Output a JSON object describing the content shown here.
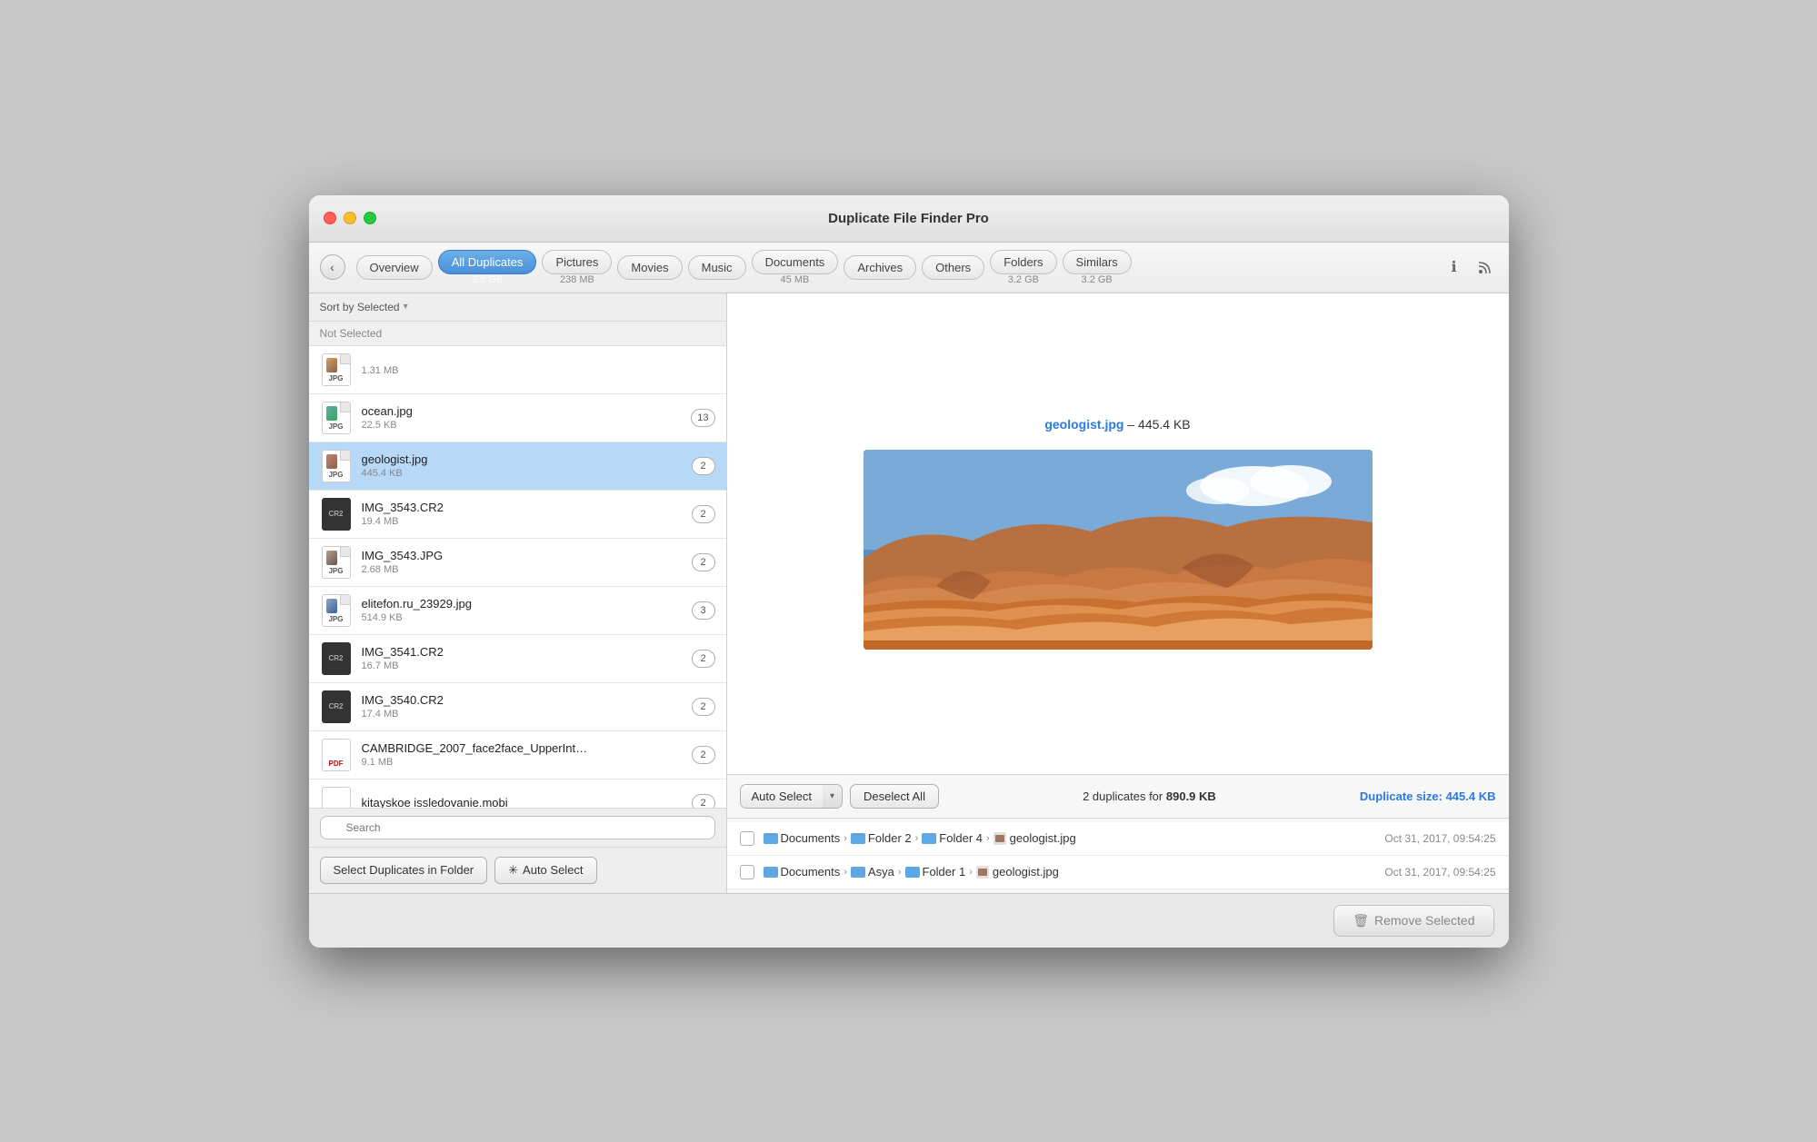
{
  "window": {
    "title": "Duplicate File Finder Pro"
  },
  "toolbar": {
    "back_label": "‹",
    "tabs": [
      {
        "id": "overview",
        "label": "Overview",
        "size": null,
        "active": false
      },
      {
        "id": "all-duplicates",
        "label": "All Duplicates",
        "size": "3.5 GB",
        "active": true
      },
      {
        "id": "pictures",
        "label": "Pictures",
        "size": "238 MB",
        "active": false
      },
      {
        "id": "movies",
        "label": "Movies",
        "size": null,
        "active": false
      },
      {
        "id": "music",
        "label": "Music",
        "size": null,
        "active": false
      },
      {
        "id": "documents",
        "label": "Documents",
        "size": "45 MB",
        "active": false
      },
      {
        "id": "archives",
        "label": "Archives",
        "size": null,
        "active": false
      },
      {
        "id": "others",
        "label": "Others",
        "size": null,
        "active": false
      },
      {
        "id": "folders",
        "label": "Folders",
        "size": "3.2 GB",
        "active": false
      },
      {
        "id": "similars",
        "label": "Similars",
        "size": "3.2 GB",
        "active": false
      }
    ]
  },
  "sort_label": "Sort by Selected",
  "section_header": "Not Selected",
  "files": [
    {
      "id": "f0",
      "name": "...",
      "size": "1.31 MB",
      "badge": "",
      "type": "jpg",
      "selected": false
    },
    {
      "id": "f1",
      "name": "ocean.jpg",
      "size": "22.5 KB",
      "badge": "13",
      "type": "jpg",
      "selected": false
    },
    {
      "id": "f2",
      "name": "geologist.jpg",
      "size": "445.4 KB",
      "badge": "2",
      "type": "jpg",
      "selected": true
    },
    {
      "id": "f3",
      "name": "IMG_3543.CR2",
      "size": "19.4 MB",
      "badge": "2",
      "type": "cr2",
      "selected": false
    },
    {
      "id": "f4",
      "name": "IMG_3543.JPG",
      "size": "2.68 MB",
      "badge": "2",
      "type": "jpg",
      "selected": false
    },
    {
      "id": "f5",
      "name": "elitefon.ru_23929.jpg",
      "size": "514.9 KB",
      "badge": "3",
      "type": "jpg",
      "selected": false
    },
    {
      "id": "f6",
      "name": "IMG_3541.CR2",
      "size": "16.7 MB",
      "badge": "2",
      "type": "cr2",
      "selected": false
    },
    {
      "id": "f7",
      "name": "IMG_3540.CR2",
      "size": "17.4 MB",
      "badge": "2",
      "type": "cr2",
      "selected": false
    },
    {
      "id": "f8",
      "name": "CAMBRIDGE_2007_face2face_UpperInt…",
      "size": "9.1 MB",
      "badge": "2",
      "type": "pdf",
      "selected": false
    },
    {
      "id": "f9",
      "name": "kitayskoe issledovanie.mobi",
      "size": "",
      "badge": "2",
      "type": "mobi",
      "selected": false
    }
  ],
  "search_placeholder": "Search",
  "bottom_buttons": {
    "select_duplicates": "Select Duplicates in Folder",
    "auto_select": "Auto Select"
  },
  "preview": {
    "title": "geologist.jpg",
    "size": "445.4 KB"
  },
  "duplicates_toolbar": {
    "auto_select": "Auto Select",
    "deselect_all": "Deselect All",
    "info": "2 duplicates for",
    "total_size": "890.9 KB",
    "dup_size_label": "Duplicate size:",
    "dup_size": "445.4 KB"
  },
  "duplicate_items": [
    {
      "id": "d1",
      "path_parts": [
        "Documents",
        "Folder 2",
        "Folder 4"
      ],
      "filename": "geologist.jpg",
      "date": "Oct 31, 2017, 09:54:25",
      "checked": false
    },
    {
      "id": "d2",
      "path_parts": [
        "Documents",
        "Asya",
        "Folder 1"
      ],
      "filename": "geologist.jpg",
      "date": "Oct 31, 2017, 09:54:25",
      "checked": false
    }
  ],
  "footer": {
    "remove_label": "Remove Selected"
  }
}
